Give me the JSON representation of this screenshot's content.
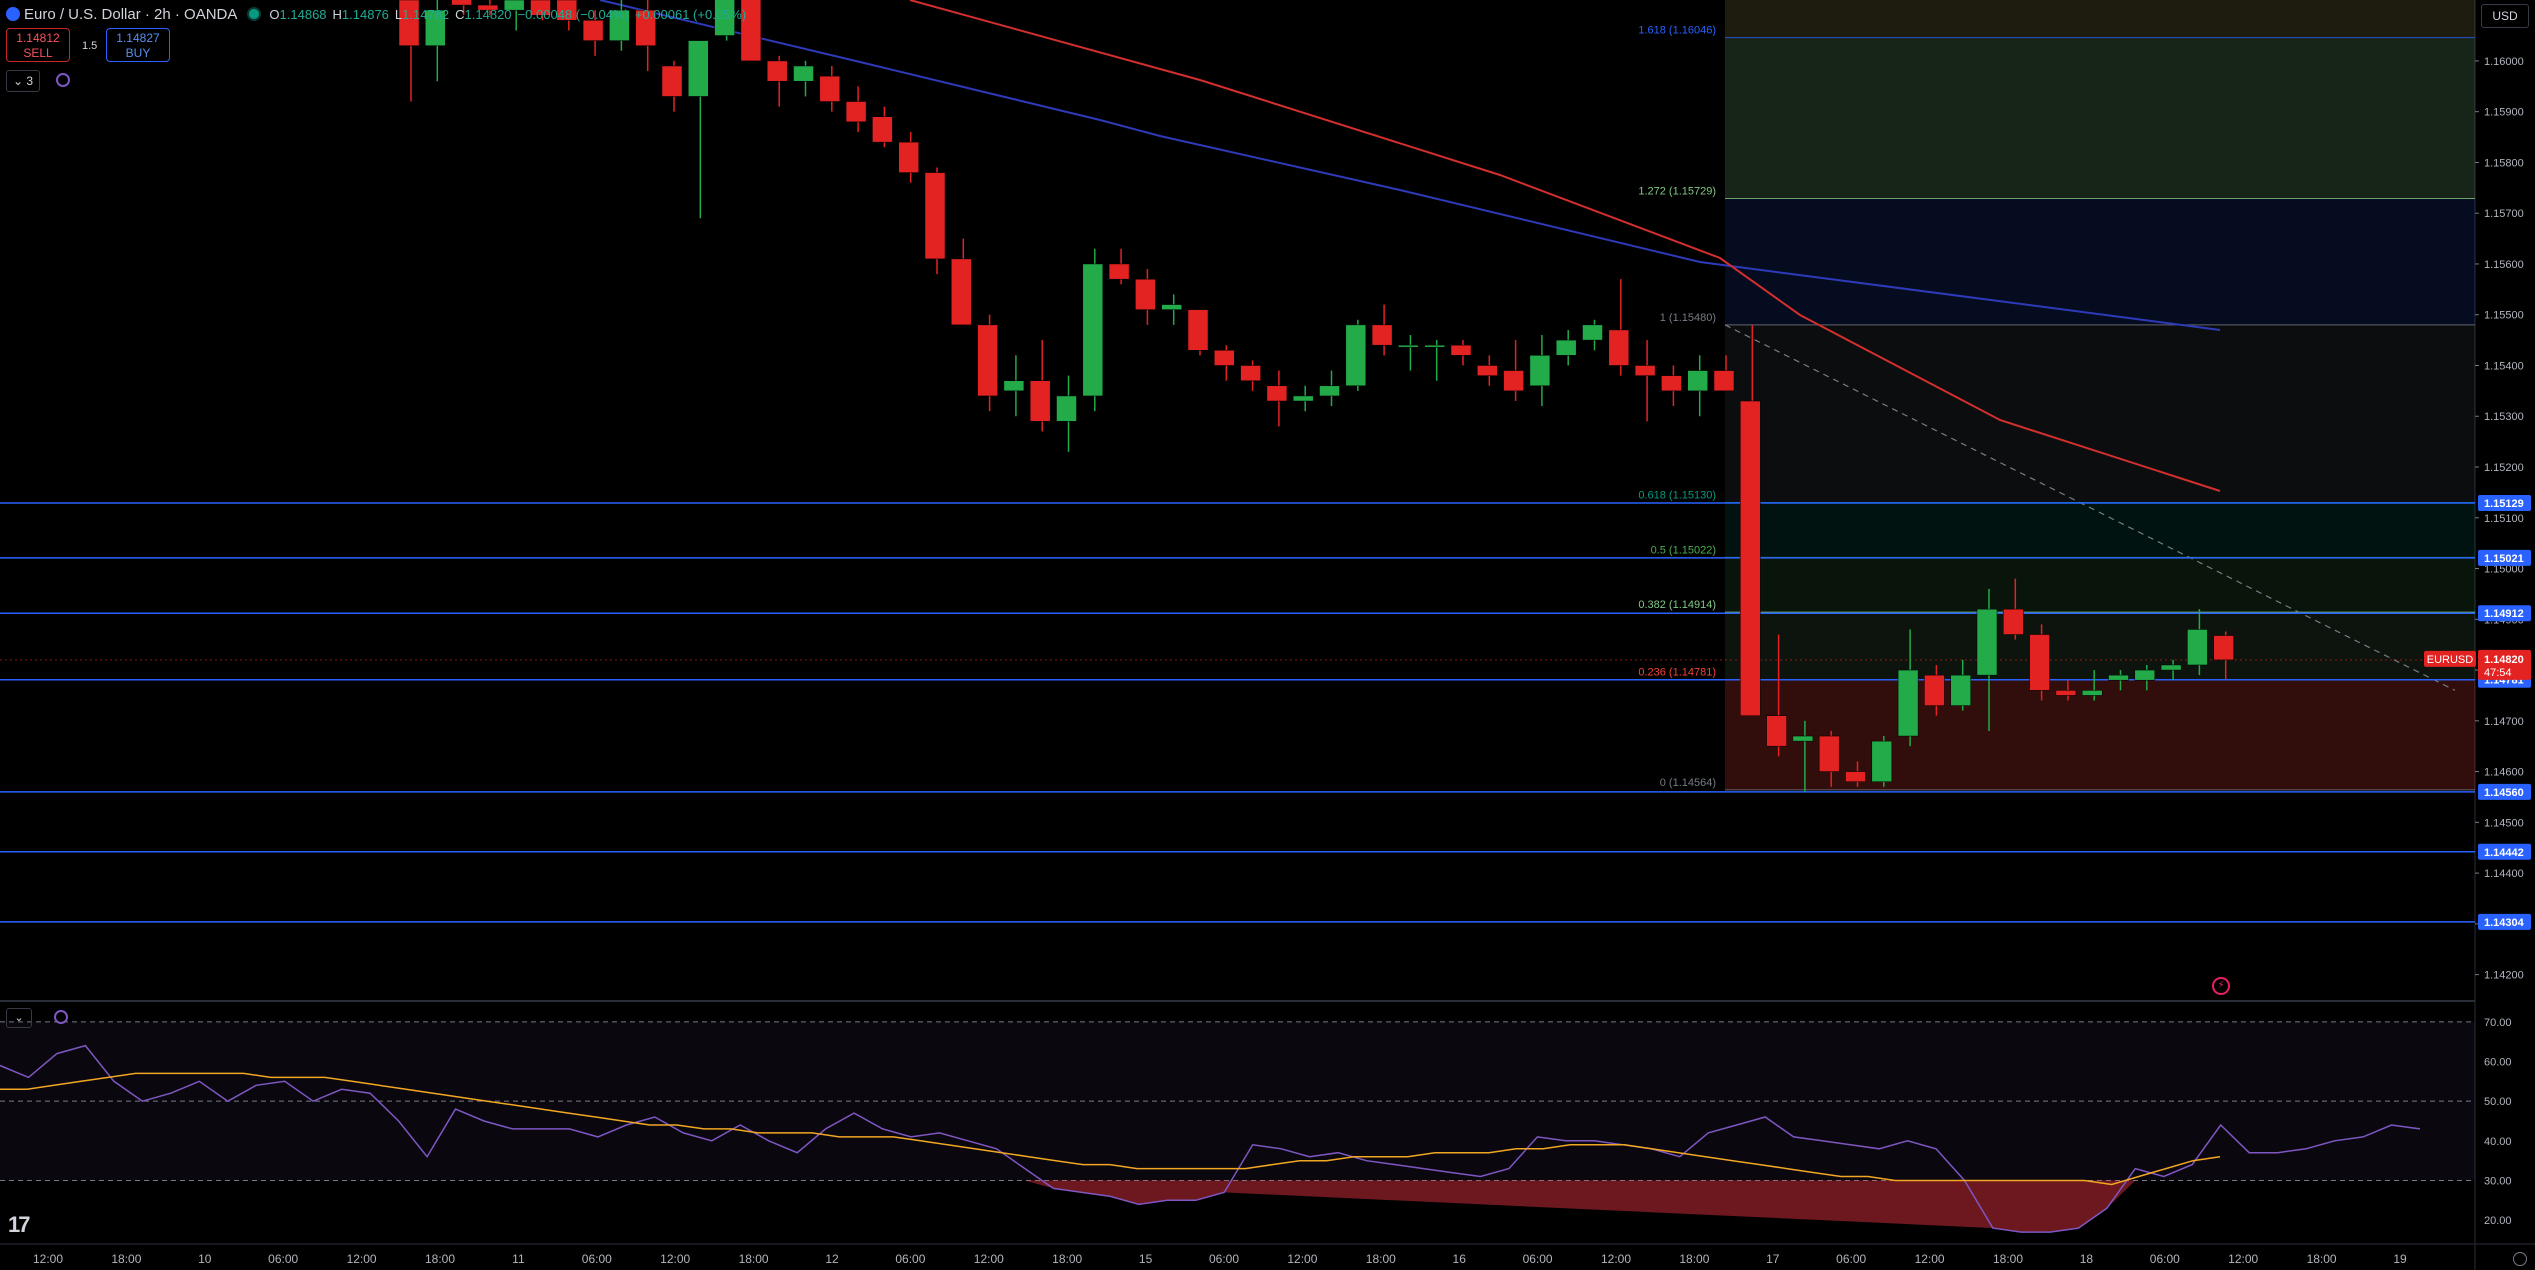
{
  "header": {
    "symbol_title": "Euro / U.S. Dollar · 2h · OANDA",
    "ohlc": [
      {
        "k": "O",
        "v": "1.14868"
      },
      {
        "k": "H",
        "v": "1.14876"
      },
      {
        "k": "L",
        "v": "1.14782"
      },
      {
        "k": "C",
        "v": "1.14820"
      }
    ],
    "change": "−0.00048 (−0.04%)",
    "change2": "+0.00061 (+0.05%)"
  },
  "trade": {
    "sell_price": "1.14812",
    "sell_label": "SELL",
    "buy_price": "1.14827",
    "buy_label": "BUY",
    "spread": "1.5"
  },
  "indicators_count": "3",
  "currency": "USD",
  "symbol_tag": "EURUSD",
  "countdown": "47:54",
  "colors": {
    "bull": "#22ab48",
    "bear": "#e32222",
    "hline": "#2962ff",
    "ma_blue": "#2e3ab9",
    "ma_red": "#d32f2f",
    "rsi": "#7e57c2",
    "rsi_ma": "#f2a723"
  },
  "chart_data": {
    "type": "candlestick",
    "price_axis": {
      "ticks": [
        "1.16000",
        "1.15900",
        "1.15800",
        "1.15700",
        "1.15600",
        "1.15500",
        "1.15400",
        "1.15300",
        "1.15200",
        "1.15100",
        "1.15000",
        "1.14900",
        "1.14800",
        "1.14700",
        "1.14600",
        "1.14500",
        "1.14400",
        "1.14300",
        "1.14200"
      ],
      "range": [
        1.1415,
        1.1612
      ]
    },
    "time_axis": {
      "labels": [
        "12:00",
        "18:00",
        "10",
        "06:00",
        "12:00",
        "18:00",
        "11",
        "06:00",
        "12:00",
        "18:00",
        "12",
        "06:00",
        "12:00",
        "18:00",
        "15",
        "06:00",
        "12:00",
        "18:00",
        "16",
        "06:00",
        "12:00",
        "18:00",
        "17",
        "06:00",
        "12:00",
        "18:00",
        "18",
        "06:00",
        "12:00",
        "18:00",
        "19"
      ]
    },
    "candles": [
      [
        1.1612,
        1.1615,
        1.1592,
        1.1603
      ],
      [
        1.1603,
        1.1615,
        1.1596,
        1.161
      ],
      [
        1.1613,
        1.1615,
        1.1609,
        1.1611
      ],
      [
        1.1611,
        1.1615,
        1.1609,
        1.161
      ],
      [
        1.161,
        1.1615,
        1.1606,
        1.1612
      ],
      [
        1.1612,
        1.1615,
        1.1608,
        1.1609
      ],
      [
        1.1612,
        1.1615,
        1.1606,
        1.1608
      ],
      [
        1.1608,
        1.161,
        1.1601,
        1.1604
      ],
      [
        1.1604,
        1.1613,
        1.1602,
        1.161
      ],
      [
        1.161,
        1.1612,
        1.1598,
        1.1603
      ],
      [
        1.1599,
        1.16,
        1.159,
        1.1593
      ],
      [
        1.1593,
        1.1602,
        1.1569,
        1.1604
      ],
      [
        1.1605,
        1.1615,
        1.1604,
        1.1614
      ],
      [
        1.1614,
        1.1616,
        1.16,
        1.16
      ],
      [
        1.16,
        1.1601,
        1.1591,
        1.1596
      ],
      [
        1.1596,
        1.16,
        1.1593,
        1.1599
      ],
      [
        1.1597,
        1.1599,
        1.159,
        1.1592
      ],
      [
        1.1592,
        1.1595,
        1.1586,
        1.1588
      ],
      [
        1.1589,
        1.1591,
        1.1583,
        1.1584
      ],
      [
        1.1584,
        1.1586,
        1.1576,
        1.1578
      ],
      [
        1.1578,
        1.1579,
        1.1558,
        1.1561
      ],
      [
        1.1561,
        1.1565,
        1.1551,
        1.1548
      ],
      [
        1.1548,
        1.155,
        1.1531,
        1.1534
      ],
      [
        1.1535,
        1.1542,
        1.153,
        1.1537
      ],
      [
        1.1537,
        1.1545,
        1.1527,
        1.1529
      ],
      [
        1.1529,
        1.1538,
        1.1523,
        1.1534
      ],
      [
        1.1534,
        1.1563,
        1.1531,
        1.156
      ],
      [
        1.156,
        1.1563,
        1.1556,
        1.1557
      ],
      [
        1.1557,
        1.1559,
        1.1548,
        1.1551
      ],
      [
        1.1551,
        1.1554,
        1.1548,
        1.1552
      ],
      [
        1.1551,
        1.1551,
        1.1542,
        1.1543
      ],
      [
        1.1543,
        1.1544,
        1.1537,
        1.154
      ],
      [
        1.154,
        1.1541,
        1.1535,
        1.1537
      ],
      [
        1.1536,
        1.1539,
        1.1528,
        1.1533
      ],
      [
        1.1533,
        1.1536,
        1.1531,
        1.1534
      ],
      [
        1.1534,
        1.1539,
        1.1532,
        1.1536
      ],
      [
        1.1536,
        1.1549,
        1.1535,
        1.1548
      ],
      [
        1.1548,
        1.1552,
        1.1542,
        1.1544
      ],
      [
        1.1544,
        1.1546,
        1.1539,
        1.1544
      ],
      [
        1.1544,
        1.1545,
        1.1537,
        1.1544
      ],
      [
        1.1544,
        1.1545,
        1.154,
        1.1542
      ],
      [
        1.154,
        1.1542,
        1.1536,
        1.1538
      ],
      [
        1.1539,
        1.1545,
        1.1533,
        1.1535
      ],
      [
        1.1536,
        1.1546,
        1.1532,
        1.1542
      ],
      [
        1.1542,
        1.1547,
        1.154,
        1.1545
      ],
      [
        1.1545,
        1.1549,
        1.1543,
        1.1548
      ],
      [
        1.1547,
        1.1557,
        1.1538,
        1.154
      ],
      [
        1.154,
        1.1545,
        1.1529,
        1.1538
      ],
      [
        1.1538,
        1.154,
        1.1532,
        1.1535
      ],
      [
        1.1535,
        1.1542,
        1.153,
        1.1539
      ],
      [
        1.1539,
        1.1542,
        1.1535,
        1.1535
      ],
      [
        1.1533,
        1.1548,
        1.1473,
        1.1471
      ],
      [
        1.1471,
        1.1487,
        1.1463,
        1.1465
      ],
      [
        1.1466,
        1.147,
        1.1456,
        1.1467
      ],
      [
        1.1467,
        1.1468,
        1.1457,
        1.146
      ],
      [
        1.146,
        1.1462,
        1.1457,
        1.1458
      ],
      [
        1.1458,
        1.1467,
        1.1457,
        1.1466
      ],
      [
        1.1467,
        1.1488,
        1.1465,
        1.148
      ],
      [
        1.1479,
        1.1481,
        1.1471,
        1.1473
      ],
      [
        1.1473,
        1.1482,
        1.1472,
        1.1479
      ],
      [
        1.1479,
        1.1496,
        1.1468,
        1.1492
      ],
      [
        1.1492,
        1.1498,
        1.1486,
        1.1487
      ],
      [
        1.1487,
        1.1489,
        1.1474,
        1.1476
      ],
      [
        1.1476,
        1.1478,
        1.1474,
        1.1475
      ],
      [
        1.1475,
        1.148,
        1.1474,
        1.1476
      ],
      [
        1.1478,
        1.148,
        1.1476,
        1.1479
      ],
      [
        1.1478,
        1.1481,
        1.1476,
        1.148
      ],
      [
        1.148,
        1.1482,
        1.1478,
        1.1481
      ],
      [
        1.1481,
        1.1492,
        1.1479,
        1.1488
      ],
      [
        1.14868,
        1.14876,
        1.14782,
        1.1482
      ]
    ],
    "moving_averages": [
      {
        "color": "blue",
        "points": [
          [
            1.1615,
            0
          ],
          [
            1.1586,
            55
          ],
          [
            1.1573,
            71
          ],
          [
            1.1548,
            84
          ]
        ]
      },
      {
        "color": "red",
        "points": [
          [
            1.1615,
            22
          ],
          [
            1.1563,
            53
          ],
          [
            1.155,
            57
          ],
          [
            1.1516,
            84
          ]
        ]
      }
    ],
    "horizontal_lines": [
      {
        "price": 1.15129,
        "label": "1.15129"
      },
      {
        "price": 1.15021,
        "label": "1.15021"
      },
      {
        "price": 1.14912,
        "label": "1.14912"
      },
      {
        "price": 1.14781,
        "label": "1.14781"
      },
      {
        "price": 1.1456,
        "label": "1.14560"
      },
      {
        "price": 1.14442,
        "label": "1.14442"
      },
      {
        "price": 1.14304,
        "label": "1.14304"
      }
    ],
    "fibonacci": [
      {
        "label": "1.618 (1.16046)",
        "price": 1.16046,
        "color": "#2962ff"
      },
      {
        "label": "1.272 (1.15729)",
        "price": 1.15729,
        "color": "#81c784"
      },
      {
        "label": "1 (1.15480)",
        "price": 1.1548,
        "color": "#787b86"
      },
      {
        "label": "0.618 (1.15130)",
        "price": 1.1513,
        "color": "#089981"
      },
      {
        "label": "0.5 (1.15022)",
        "price": 1.15022,
        "color": "#4caf50"
      },
      {
        "label": "0.382 (1.14914)",
        "price": 1.14914,
        "color": "#81c784"
      },
      {
        "label": "0.236 (1.14781)",
        "price": 1.14781,
        "color": "#f44336"
      },
      {
        "label": "0 (1.14564)",
        "price": 1.14564,
        "color": "#787b86"
      }
    ],
    "current_price": "1.14820",
    "rsi": {
      "ticks": [
        "70.00",
        "60.00",
        "50.00",
        "40.00",
        "30.00",
        "20.00"
      ],
      "range": [
        15,
        75
      ],
      "levels": [
        70,
        50,
        30
      ],
      "values": [
        59,
        56,
        62,
        64,
        55,
        50,
        52,
        55,
        50,
        54,
        55,
        50,
        53,
        52,
        45,
        36,
        48,
        45,
        43,
        43,
        43,
        41,
        44,
        46,
        42,
        40,
        44,
        40,
        37,
        43,
        47,
        43,
        41,
        42,
        40,
        38,
        33,
        28,
        27,
        26,
        24,
        25,
        25,
        27,
        39,
        38,
        36,
        37,
        35,
        34,
        33,
        32,
        31,
        33,
        41,
        40,
        40,
        39,
        38,
        36,
        42,
        44,
        46,
        41,
        40,
        39,
        38,
        40,
        38,
        30,
        18,
        17,
        17,
        18,
        23,
        33,
        31,
        34,
        44,
        37,
        37,
        38,
        40,
        41,
        44,
        43
      ],
      "ma_values": [
        53,
        53,
        54,
        55,
        56,
        57,
        57,
        57,
        57,
        57,
        56,
        56,
        56,
        55,
        54,
        53,
        52,
        51,
        50,
        49,
        48,
        47,
        46,
        45,
        44,
        44,
        43,
        43,
        42,
        42,
        42,
        41,
        41,
        41,
        40,
        39,
        38,
        37,
        36,
        35,
        34,
        34,
        33,
        33,
        33,
        33,
        33,
        34,
        35,
        35,
        36,
        36,
        36,
        37,
        37,
        37,
        38,
        38,
        39,
        39,
        39,
        38,
        37,
        36,
        35,
        34,
        33,
        32,
        31,
        31,
        30,
        30,
        30,
        30,
        30,
        30,
        30,
        30,
        29,
        31,
        33,
        35,
        36
      ]
    }
  }
}
